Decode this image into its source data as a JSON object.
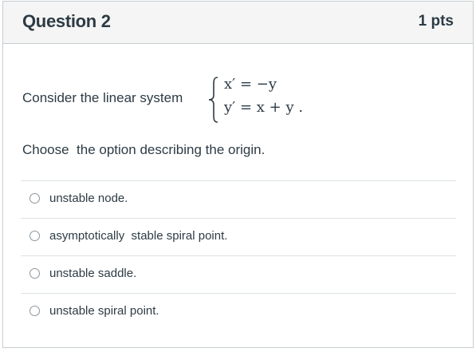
{
  "question": {
    "title": "Question 2",
    "points": "1 pts",
    "prompt": "Consider the linear system",
    "system": {
      "equation_1": "x′ = −y",
      "equation_2": "y′ = x + y ."
    },
    "instruction": "Choose  the option describing the origin."
  },
  "answers": [
    {
      "label": "unstable node.",
      "selected": false
    },
    {
      "label": "asymptotically  stable spiral point.",
      "selected": false
    },
    {
      "label": "unstable saddle.",
      "selected": false
    },
    {
      "label": "unstable spiral point.",
      "selected": false
    }
  ],
  "colors": {
    "text": "#2d3b45",
    "header_bg": "#f5f5f5",
    "border": "#c7cdd1",
    "divider": "#dde2e5"
  },
  "icons": {
    "radio": "radio-unselected-icon"
  }
}
